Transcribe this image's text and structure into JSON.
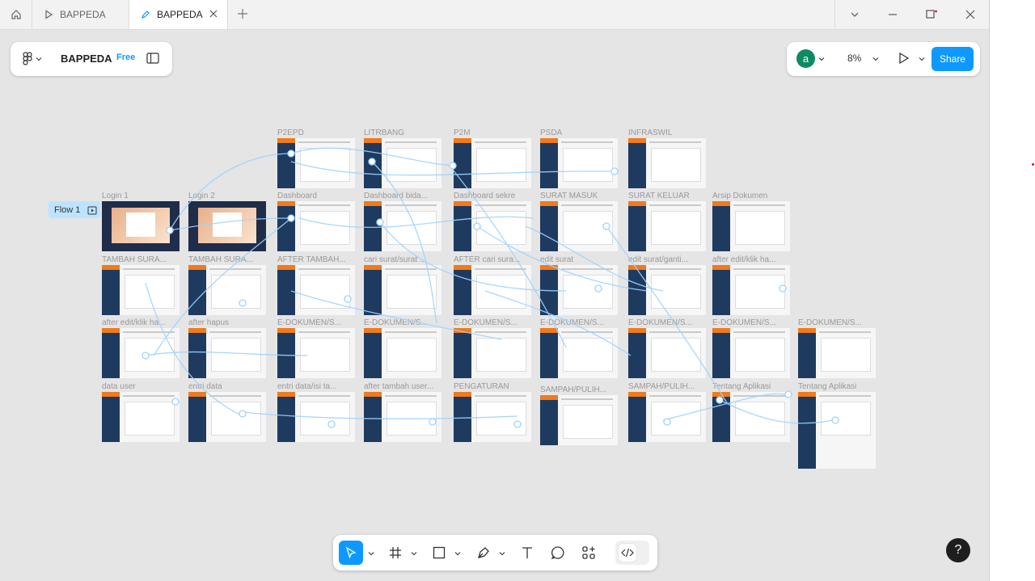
{
  "tabs": [
    {
      "label": "BAPPEDA",
      "kind": "prototype"
    },
    {
      "label": "BAPPEDA",
      "kind": "design",
      "active": true
    }
  ],
  "file": {
    "name": "BAPPEDA",
    "plan": "Free"
  },
  "user": {
    "initial": "a"
  },
  "zoom": "8%",
  "share_label": "Share",
  "flow_label": "Flow 1",
  "help_label": "?",
  "rows": [
    {
      "y": 0,
      "labels": [
        "",
        "",
        "P2EPD",
        "LITRBANG",
        "P2M",
        "PSDA",
        "INFRASWIL",
        ""
      ]
    },
    {
      "y": 1,
      "labels": [
        "Login 1",
        "Login 2",
        "Dashboard",
        "Dashboard bida...",
        "Dashboard sekre",
        "SURAT MASUK",
        "SURAT KELUAR",
        "Arsip Dokumen"
      ]
    },
    {
      "y": 2,
      "labels": [
        "TAMBAH SURA...",
        "TAMBAH SURA...",
        "AFTER TAMBAH...",
        "cari surat/surat ...",
        "AFTER cari sura...",
        "edit surat",
        "edit surat/ganti...",
        "after edit/klik ha..."
      ]
    },
    {
      "y": 3,
      "labels": [
        "after edit/klik ha...",
        "after hapus",
        "E-DOKUMEN/S...",
        "E-DOKUMEN/S...",
        "E-DOKUMEN/S...",
        "E-DOKUMEN/S...",
        "E-DOKUMEN/S...",
        "E-DOKUMEN/S...",
        "E-DOKUMEN/S..."
      ]
    },
    {
      "y": 4,
      "labels": [
        "data user",
        "entri data",
        "entri data/isi ta...",
        "after tambah user...",
        "PENGATURAN",
        "SAMPAH/PULIH...",
        "SAMPAH/PULIH...",
        "Tentang Aplikasi",
        "Tentang Aplikasi"
      ]
    }
  ]
}
